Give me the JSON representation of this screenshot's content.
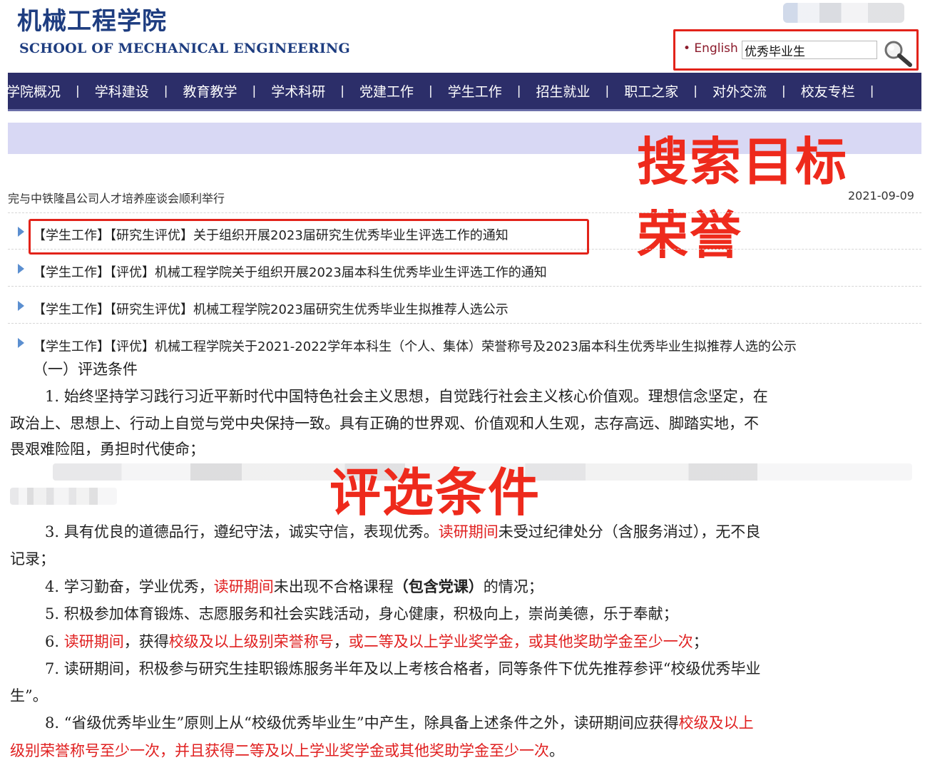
{
  "header": {
    "school_cn": "机械工程学院",
    "school_en": "SCHOOL OF MECHANICAL ENGINEERING",
    "english_link": "• English",
    "search_value": "优秀毕业生"
  },
  "nav": {
    "items": [
      "学院概况",
      "学科建设",
      "教育教学",
      "学术科研",
      "党建工作",
      "学生工作",
      "招生就业",
      "职工之家",
      "对外交流",
      "校友专栏"
    ],
    "separator": "|"
  },
  "annotations": {
    "search_target_line1": "搜索目标",
    "search_target_line2": "荣誉",
    "criteria": "评选条件"
  },
  "news": {
    "first_title": "完与中铁隆昌公司人才培养座谈会顺利举行",
    "first_date": "2021-09-09",
    "items": [
      "【学生工作】【研究生评优】关于组织开展2023届研究生优秀毕业生评选工作的通知",
      "【学生工作】【评优】机械工程学院关于组织开展2023届本科生优秀毕业生评选工作的通知",
      "【学生工作】【研究生评优】机械工程学院2023届研究生优秀毕业生拟推荐人选公示",
      "【学生工作】【评优】机械工程学院关于2021-2022学年本科生（个人、集体）荣誉称号及2023届本科生优秀毕业生拟推荐人选的公示"
    ]
  },
  "doc": {
    "heading": "（一）评选条件",
    "c1_line1": "1. 始终坚持学习践行习近平新时代中国特色社会主义思想，自觉践行社会主义核心价值观。理想信念坚定，在",
    "c1_line2": "政治上、思想上、行动上自觉与党中央保持一致。具有正确的世界观、价值观和人生观，志存高远、脚踏实地，不",
    "c1_line3": "畏艰难险阻，勇担时代使命；",
    "c3_a": "3. 具有优良的道德品行，遵纪守法，诚实守信，表现优秀。",
    "c3_b": "读研期间",
    "c3_c": "未受过纪律处分（含服务消过），无不良",
    "c3_line2": "记录；",
    "c4_a": "4. 学习勤奋，学业优秀，",
    "c4_b": "读研期间",
    "c4_c": "未出现不合格课程",
    "c4_d": "（包含党课）",
    "c4_e": "的情况；",
    "c5": "5. 积极参加体育锻炼、志愿服务和社会实践活动，身心健康，积极向上，崇尚美德，乐于奉献；",
    "c6_a": "6. ",
    "c6_b": "读研期间",
    "c6_c": "，获得",
    "c6_d": "校级及以上级别荣誉称号",
    "c6_e": "，",
    "c6_f": "或二等及以上学业奖学金，或其他奖助学金至少一次",
    "c6_g": "；",
    "c7_line1": "7. 读研期间，积极参与研究生挂职锻炼服务半年及以上考核合格者，同等条件下优先推荐参评“校级优秀毕业",
    "c7_line2": "生”。",
    "c8_a": "8. “省级优秀毕业生”原则上从“校级优秀毕业生”中产生，除具备上述条件之外，读研期间应获得",
    "c8_b": "校级及以上",
    "c8_line2_a": "级别荣誉称号至少一次",
    "c8_line2_b": "，并且获得二等及以上学业奖学金或其他奖助学金至少一次",
    "c8_line2_c": "。"
  }
}
